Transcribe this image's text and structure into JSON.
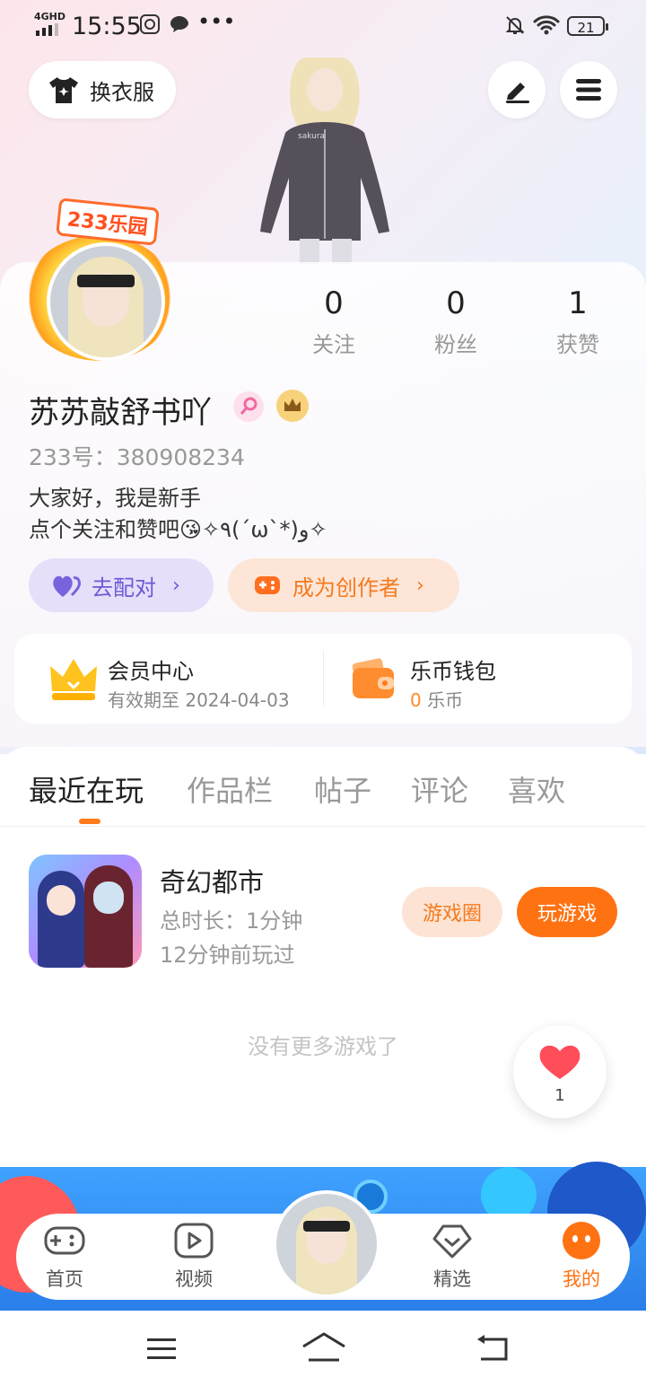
{
  "status_bar": {
    "network": "4GHD",
    "time": "15:55",
    "battery": "21"
  },
  "header": {
    "outfit_button": "换衣服",
    "edit_icon": "pen-icon",
    "menu_icon": "menu-icon"
  },
  "avatar": {
    "frame_badge": "233乐园"
  },
  "stats": [
    {
      "value": "0",
      "label": "关注"
    },
    {
      "value": "0",
      "label": "粉丝"
    },
    {
      "value": "1",
      "label": "获赞"
    }
  ],
  "profile": {
    "name": "苏苏敲舒书吖",
    "uid": "233号：380908234",
    "bio_line1": "大家好，我是新手",
    "bio_line2": "点个关注和赞吧😘✧٩(ˊωˋ*)و✧"
  },
  "chips": {
    "match_label": "去配对",
    "creator_label": "成为创作者"
  },
  "vip": {
    "title": "会员中心",
    "expiry": "有效期至 2024-04-03",
    "wallet_title": "乐币钱包",
    "coin_value": "0",
    "coin_unit": "乐币"
  },
  "tabs": [
    "最近在玩",
    "作品栏",
    "帖子",
    "评论",
    "喜欢"
  ],
  "recent_game": {
    "title": "奇幻都市",
    "duration": "总时长：1分钟",
    "last_played": "12分钟前玩过",
    "circle_button": "游戏圈",
    "play_button": "玩游戏"
  },
  "empty_hint": "没有更多游戏了",
  "like_float": {
    "count": "1"
  },
  "bottom_nav": {
    "home": "首页",
    "video": "视频",
    "featured": "精选",
    "mine": "我的"
  },
  "colors": {
    "accent": "#ff7a1a",
    "purple": "#6b5bd6",
    "orange_text": "#f57a1f"
  }
}
